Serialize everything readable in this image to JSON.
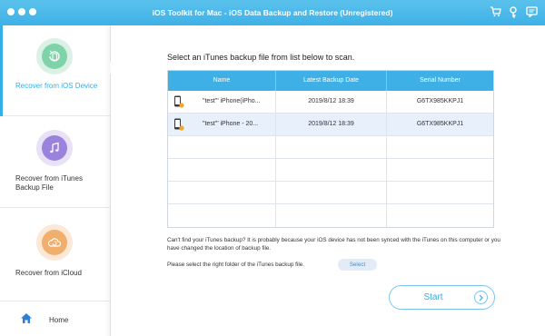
{
  "window": {
    "title": "iOS Toolkit for Mac - iOS Data Backup and Restore (Unregistered)"
  },
  "toolbar": {
    "icons": [
      "cart-icon",
      "key-icon",
      "feedback-icon"
    ]
  },
  "sidebar": {
    "items": [
      {
        "label": "Recover from iOS Device",
        "icon": "ios-device-icon",
        "active": true,
        "color": "#36aee8"
      },
      {
        "label": "Recover from iTunes Backup File",
        "icon": "itunes-music-icon",
        "active": false,
        "color": "#7d5fd0"
      },
      {
        "label": "Recover from iCloud",
        "icon": "icloud-icon",
        "active": false,
        "color": "#f0a35a"
      }
    ],
    "home": {
      "label": "Home",
      "icon": "home-icon"
    }
  },
  "main": {
    "heading": "Select an iTunes backup file from list below to scan.",
    "table": {
      "columns": [
        "Name",
        "Latest Backup Date",
        "Serial Number"
      ],
      "rows": [
        {
          "name": "\"test\"’ iPhone(iPho...",
          "date": "2019/8/12 18:39",
          "serial": "G6TX985KKPJ1",
          "selected": false
        },
        {
          "name": "\"test\"’ iPhone - 20...",
          "date": "2019/8/12 18:39",
          "serial": "G6TX985KKPJ1",
          "selected": true
        }
      ],
      "empty_rows": 4
    },
    "hint": "Can't find your iTunes backup? It is probably because your iOS device has not been synced with the iTunes on this computer or you have changed the location of backup file.",
    "select_hint": "Please select the right folder of the iTunes backup file.",
    "select_label": "Select",
    "start_label": "Start"
  },
  "colors": {
    "accent": "#36aee8",
    "header": "#3fb0e6",
    "selected_row": "#e8f0fb"
  }
}
